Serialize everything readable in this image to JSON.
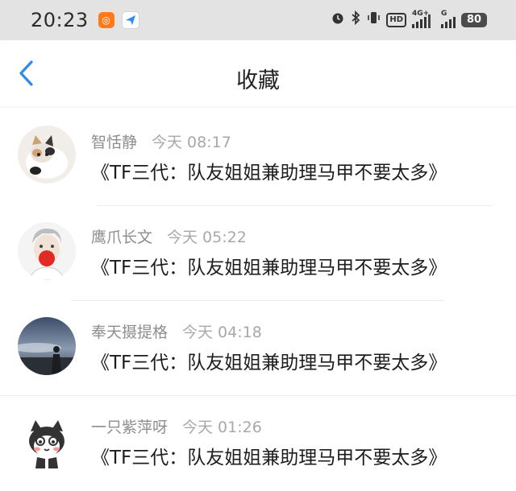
{
  "status_bar": {
    "time": "20:23",
    "app_icons": [
      "taobao-icon",
      "send-app-icon"
    ],
    "right_icons": [
      "alarm-icon",
      "bluetooth-icon",
      "vibrate-icon"
    ],
    "hd_label": "HD",
    "signal1_label": "4G+",
    "signal2_label": "G",
    "battery": "80"
  },
  "header": {
    "title": "收藏",
    "back_icon": "chevron-left-icon",
    "accent": "#2f8be8"
  },
  "items": [
    {
      "name": "智恬静",
      "time": "今天  08:17",
      "message": "《TF三代：队友姐姐兼助理马甲不要太多》"
    },
    {
      "name": "鹰爪长文",
      "time": "今天  05:22",
      "message": "《TF三代：队友姐姐兼助理马甲不要太多》"
    },
    {
      "name": "奉天摄提格",
      "time": "今天  04:18",
      "message": "《TF三代：队友姐姐兼助理马甲不要太多》"
    },
    {
      "name": "一只紫萍呀",
      "time": "今天  01:26",
      "message": "《TF三代：队友姐姐兼助理马甲不要太多》"
    }
  ]
}
